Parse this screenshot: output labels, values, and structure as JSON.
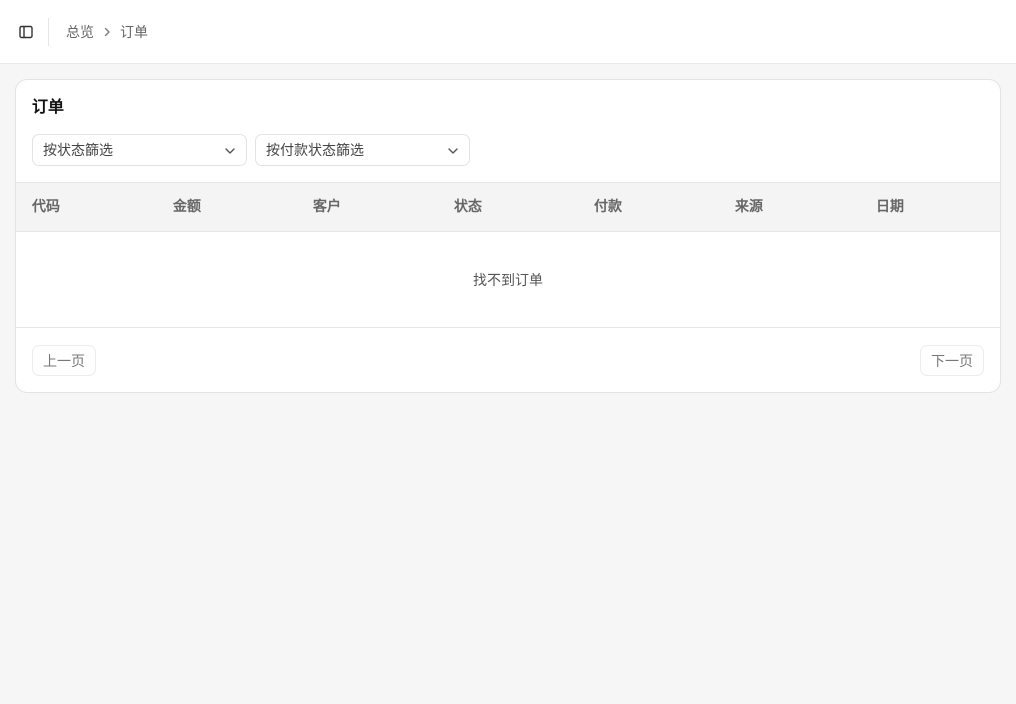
{
  "topbar": {
    "toggle_icon": "sidebar-panel-icon",
    "breadcrumb": {
      "parent": "总览",
      "separator_icon": "chevron-right-icon",
      "current": "订单"
    }
  },
  "card": {
    "title": "订单",
    "filters": {
      "status": {
        "value": "按状态篩选",
        "icon": "chevron-down-icon"
      },
      "payment_status": {
        "value": "按付款状态篩选",
        "icon": "chevron-down-icon"
      }
    },
    "table": {
      "columns": [
        "代码",
        "金额",
        "客户",
        "状态",
        "付款",
        "来源",
        "日期"
      ],
      "rows": [],
      "empty_text": "找不到订单"
    },
    "pagination": {
      "prev_label": "上一页",
      "next_label": "下一页"
    }
  },
  "colors": {
    "page_background": "#f6f6f6",
    "card_background": "#ffffff",
    "table_header_background": "#f4f4f4",
    "border": "#e3e3e3"
  }
}
